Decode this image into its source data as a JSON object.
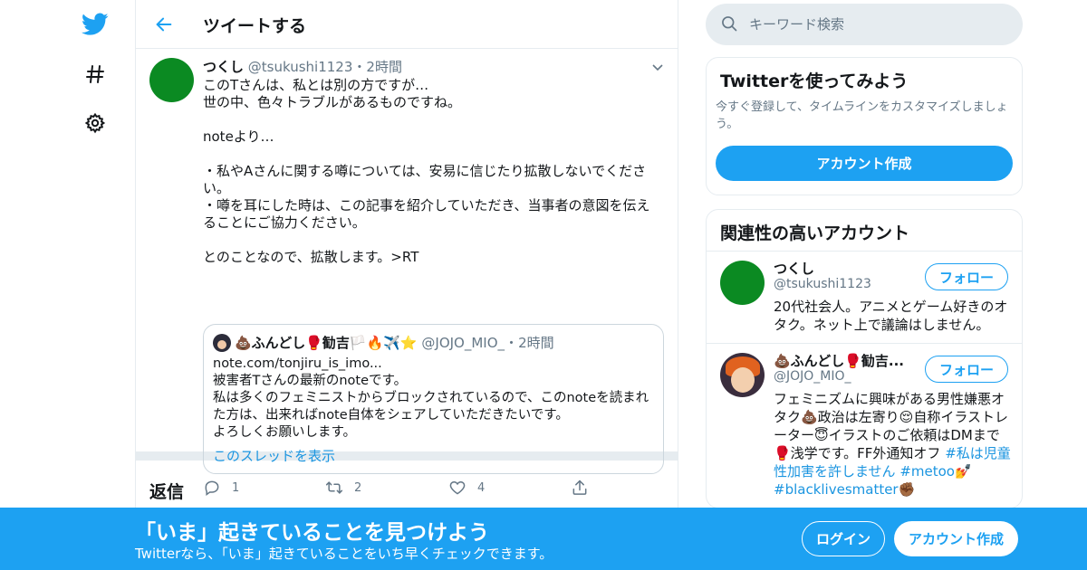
{
  "colors": {
    "accent": "#1da1f2",
    "link": "#1b95e0",
    "muted": "#657786",
    "border": "#e6ecf0"
  },
  "nav": {
    "logo_icon": "twitter-bird-icon",
    "explore_icon": "hashtag-icon",
    "settings_icon": "gear-icon"
  },
  "header": {
    "title": "ツイートする",
    "back_icon": "arrow-left-icon"
  },
  "tweet": {
    "name": "つくし",
    "handle": "@tsukushi1123",
    "separator": "・",
    "time": "2時間",
    "text": "このTさんは、私とは別の方ですが…\n世の中、色々トラブルがあるものですね。\n\nnoteより…\n\n・私やAさんに関する噂については、安易に信じたり拡散しないでください。\n・噂を耳にした時は、この記事を紹介していただき、当事者の意図を伝えることにご協力ください。\n\nとのことなので、拡散します。>RT",
    "quote": {
      "name": "💩ふんどし🥊勧吉🏳️🔥✈️⭐",
      "handle": "@JOJO_MIO_",
      "separator": "・",
      "time": "2時間",
      "text": "note.com/tonjiru_is_imo...\n被害者Tさんの最新のnoteです。\n私は多くのフェミニストからブロックされているので、このnoteを読まれた方は、出来ればnote自体をシェアしていただきたいです。\nよろしくお願いします。",
      "thread_link": "このスレッドを表示"
    },
    "actions": {
      "replies": "1",
      "retweets": "2",
      "likes": "4"
    }
  },
  "replies_title": "返信",
  "search": {
    "placeholder": "キーワード検索"
  },
  "signup_card": {
    "title": "Twitterを使ってみよう",
    "description": "今すぐ登録して、タイムラインをカスタマイズしましょう。",
    "button": "アカウント作成"
  },
  "related": {
    "title": "関連性の高いアカウント",
    "accounts": [
      {
        "name": "つくし",
        "handle": "@tsukushi1123",
        "follow": "フォロー",
        "bio": "20代社会人。アニメとゲーム好きのオタク。ネット上で議論はしません。"
      },
      {
        "name": "💩ふんどし🥊勧吉...",
        "handle": "@JOJO_MIO_",
        "follow": "フォロー",
        "bio_text": "フェミニズムに興味がある男性嫌悪オタク💩政治は左寄り😌自称イラストレーター😇イラストのご依頼はDMまで🥊浅学です。FF外通知オフ ",
        "bio_tags": [
          "#私は児童性加害を許しません",
          "#metoo",
          "#blacklivesmatter"
        ],
        "bio_emoji": [
          "💅",
          "✊🏾"
        ]
      }
    ]
  },
  "bottom_bar": {
    "title": "「いま」起きていることを見つけよう",
    "subtitle": "Twitterなら、「いま」起きていることをいち早くチェックできます。",
    "login": "ログイン",
    "signup": "アカウント作成"
  }
}
